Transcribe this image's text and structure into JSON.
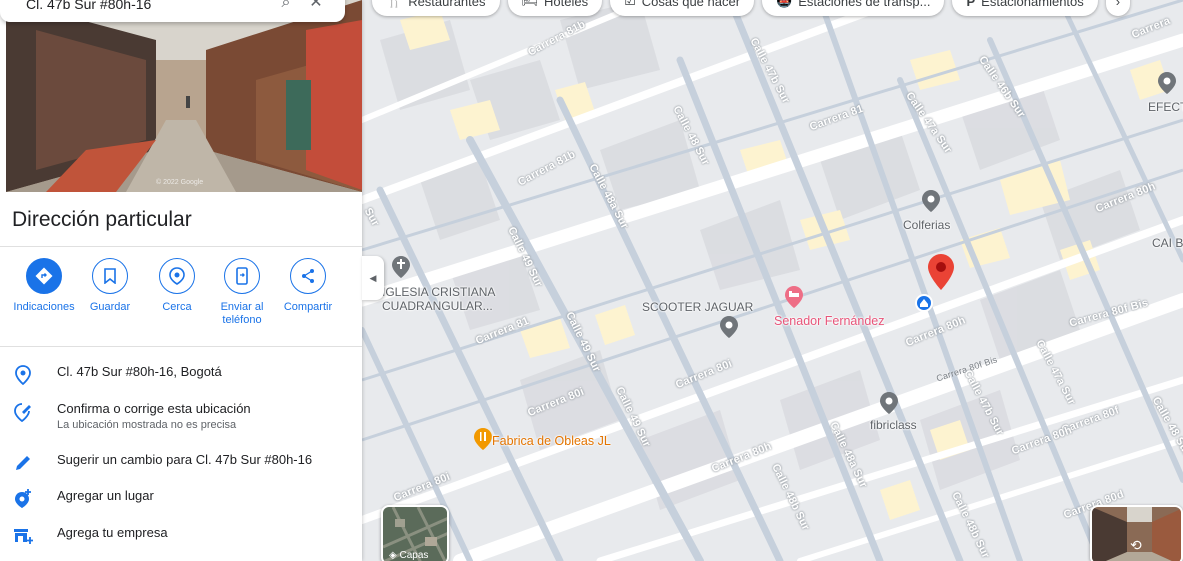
{
  "search": {
    "query": "Cl. 47b Sur #80h-16"
  },
  "chips": [
    {
      "icon": "restaurant-icon",
      "label": "Restaurantes"
    },
    {
      "icon": "hotel-icon",
      "label": "Hoteles"
    },
    {
      "icon": "activities-icon",
      "label": "Cosas que hacer"
    },
    {
      "icon": "transit-icon",
      "label": "Estaciones de transp..."
    },
    {
      "icon": "parking-icon",
      "label": "Estacionamientos"
    }
  ],
  "photo": {
    "watermark": "© 2022 Google"
  },
  "place": {
    "title": "Dirección particular"
  },
  "actions": [
    {
      "label": "Indicaciones"
    },
    {
      "label": "Guardar"
    },
    {
      "label": "Cerca"
    },
    {
      "label": "Enviar al teléfono"
    },
    {
      "label": "Compartir"
    }
  ],
  "rows": {
    "address": "Cl. 47b Sur #80h-16, Bogotá",
    "confirm_title": "Confirma o corrige esta ubicación",
    "confirm_sub": "La ubicación mostrada no es precisa",
    "suggest": "Sugerir un cambio para Cl. 47b Sur #80h-16",
    "add_place": "Agregar un lugar",
    "add_business": "Agrega tu empresa"
  },
  "map": {
    "layers_label": "Capas",
    "pois": {
      "iglesia": "IGLESIA CRISTIANA\nCUADRANGULAR...",
      "scooter": "SCOOTER JAGUAR",
      "senador": "Senador Fernández",
      "colferias": "Colferias",
      "cai": "CAI B",
      "efect": "EFECT",
      "fibriclass": "fibriclass",
      "obleas": "Fabrica de Obleas JL"
    },
    "streets": {
      "carrera81b_a": "Carrera 81b",
      "carrera81b_b": "Carrera 81b",
      "carrera81_a": "Carrera 81",
      "carrera81_b": "Carrera 81",
      "carrera80h_a": "Carrera 80h",
      "carrera80h_b": "Carrera 80h",
      "carrera80f_bis": "Carrera 80f Bis",
      "carrera80f_bis_b": "Carrera 80f Bis",
      "carrera80f": "Carrera 80f",
      "carrera80d": "Carrera 80d",
      "carrera80i_a": "Carrera 80i",
      "carrera80i_b": "Carrera 80i",
      "carrera80i_c": "Carrera 80i",
      "carrera80h_c": "Carrera 80h",
      "carrera80h_d": "Carrera 80h",
      "calle47b": "Calle 47b Sur",
      "calle47a": "Calle 47a Sur",
      "calle46b": "Calle 46b Sur",
      "calle48": "Calle 48 Sur",
      "calle48a": "Calle 48a Sur",
      "calle49_a": "Calle 49 Sur",
      "calle49_b": "Calle 49 Sur",
      "calle49_c": "Calle 49 Sur",
      "calle48a_b": "Calle 48a Sur",
      "calle48b": "Calle 48b Sur",
      "calle48b_b": "Calle 48b Sur",
      "calle47a_b": "Calle 47a Sur",
      "calle47b_b": "Calle 47b Sur",
      "sur": "Sur",
      "carrera": "Carrera",
      "calle49_d": "Calle 49 Sur",
      "calle48_b": "Calle 48 Sur",
      "calle47_c": "Calle 47",
      "carrera80f_b": "Carrera 80f"
    }
  },
  "colors": {
    "accent": "#1a73e8",
    "pin": "#ea4335",
    "road": "#ffffff",
    "block": "#e8eaed",
    "building": "#dadce0",
    "highlight": "#fdf3d0"
  }
}
